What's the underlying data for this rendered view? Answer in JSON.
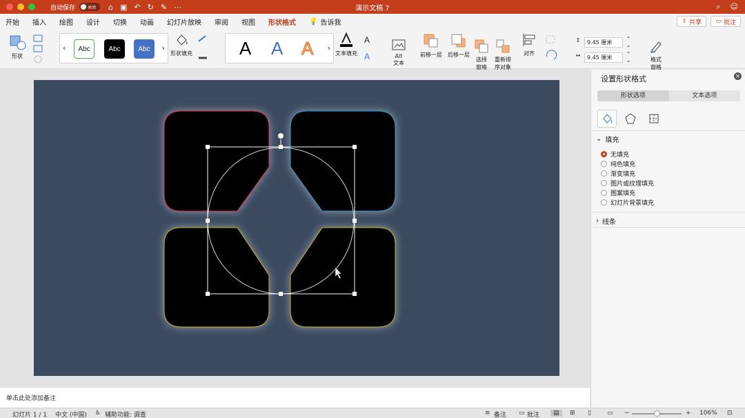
{
  "titlebar": {
    "autosave_label": "自动保存",
    "autosave_state": "关闭",
    "doc_title": "演示文稿 7"
  },
  "tabs": [
    {
      "label": "开始"
    },
    {
      "label": "插入"
    },
    {
      "label": "绘图"
    },
    {
      "label": "设计"
    },
    {
      "label": "切换"
    },
    {
      "label": "动画"
    },
    {
      "label": "幻灯片放映"
    },
    {
      "label": "审阅"
    },
    {
      "label": "视图"
    },
    {
      "label": "形状格式"
    },
    {
      "label": "告诉我"
    }
  ],
  "active_tab": "形状格式",
  "share_label": "共享",
  "comment_label": "批注",
  "ribbon": {
    "shape_label": "形状",
    "style_samples": [
      "Abc",
      "Abc",
      "Abc"
    ],
    "shape_fill_label": "形状填充",
    "wordart_samples": [
      "A",
      "A",
      "A"
    ],
    "text_fill_label": "文本填充",
    "alt_text_label": "Alt\n文本",
    "bring_forward_label": "前移一层",
    "send_backward_label": "后移一层",
    "selection_pane_label": "选择\n窗格",
    "reorder_label": "重新排\n序对象",
    "align_label": "对齐",
    "height_value": "9.45 厘米",
    "width_value": "9.45 厘米",
    "format_pane_label": "格式\n窗格"
  },
  "notes_placeholder": "单击此处添加备注",
  "pane": {
    "title": "设置形状格式",
    "tab_shape": "形状选项",
    "tab_text": "文本选项",
    "fill_section": "填充",
    "fill_options": [
      "无填充",
      "纯色填充",
      "渐变填充",
      "图片或纹理填充",
      "图案填充",
      "幻灯片背景填充"
    ],
    "selected_fill": "无填充",
    "line_section": "线条"
  },
  "status": {
    "slide_pos": "幻灯片 1 / 1",
    "language": "中文 (中国)",
    "accessibility": "辅助功能: 调查",
    "notes_btn": "备注",
    "comments_btn": "批注",
    "zoom": "106%"
  },
  "colors": {
    "accent": "#c43e1c",
    "slide_bg": "#3b4a5f",
    "tile_fill": "#000000",
    "tile_top_left_edge": "#e0245e",
    "tile_top_right_edge": "#1e9bd7",
    "tile_bottom_edges": "#c9b400"
  }
}
